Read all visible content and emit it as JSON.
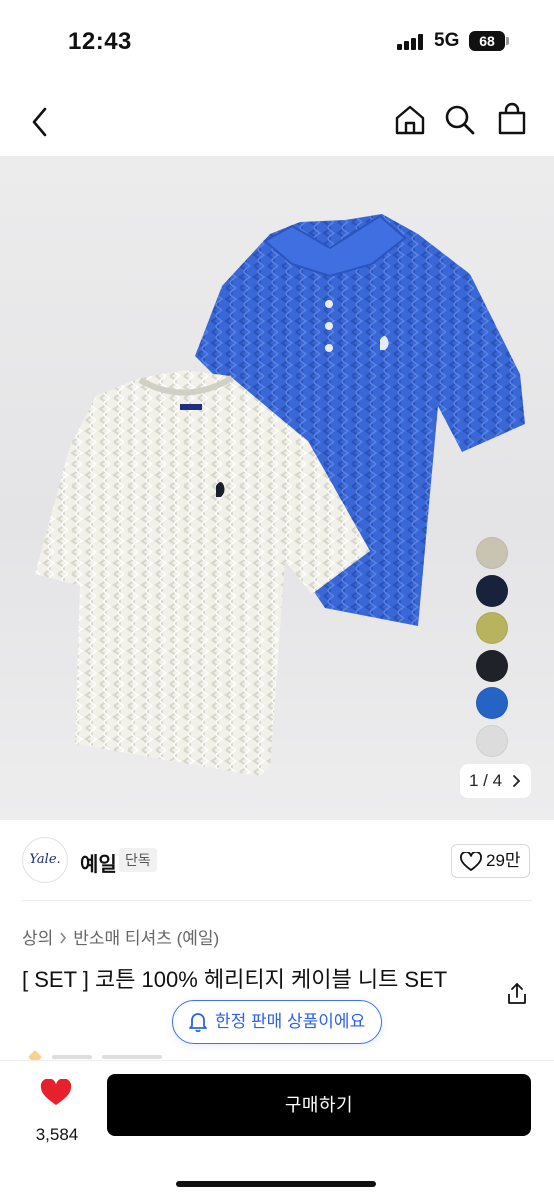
{
  "status": {
    "time": "12:43",
    "network": "5G",
    "battery": "68"
  },
  "nav": {
    "back_icon": "chevron-left-icon",
    "home_icon": "home-icon",
    "search_icon": "search-icon",
    "cart_icon": "shopping-bag-icon"
  },
  "gallery": {
    "pager_text": "1 / 4",
    "swatches": [
      "#c9c3b2",
      "#18223a",
      "#b8b35e",
      "#1f2229",
      "#2563c4",
      "#dcdcdc"
    ]
  },
  "brand": {
    "logo_text": "Yale.",
    "name": "예일",
    "tag": "단독",
    "likes": "29만"
  },
  "breadcrumb": {
    "parent": "상의",
    "child": "반소매 티셔츠 (예일)"
  },
  "product": {
    "title": "[ SET ] 코튼 100% 헤리티지 케이블 니트 SET",
    "limited_notice": "한정 판매 상품이에요"
  },
  "actions": {
    "favorite_count": "3,584",
    "buy_label": "구매하기"
  },
  "colors": {
    "accent_blue": "#2e62e8",
    "heart_red": "#e8202b",
    "button_black": "#000000"
  }
}
